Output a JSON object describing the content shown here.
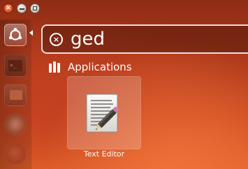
{
  "window_controls": {
    "close_glyph": "×",
    "minimize_icon": "minimize-icon",
    "maximize_icon": "maximize-icon"
  },
  "launcher": {
    "items": [
      {
        "name": "dash-home",
        "icon": "ubuntu-logo-icon",
        "active": true
      },
      {
        "name": "terminal",
        "icon": "terminal-icon",
        "glyph": ">_"
      },
      {
        "name": "files",
        "icon": "files-icon"
      },
      {
        "name": "browser",
        "icon": "chromium-icon"
      },
      {
        "name": "firefox",
        "icon": "firefox-icon"
      }
    ]
  },
  "search": {
    "value": "ged",
    "clear_glyph": "×"
  },
  "category": {
    "label": "Applications",
    "icon": "applications-icon"
  },
  "results": [
    {
      "label": "Text Editor",
      "icon": "text-editor-icon",
      "highlighted": true
    }
  ],
  "colors": {
    "accent": "#e4521d",
    "background_top": "#8e2c14",
    "background_bottom": "#e2622b",
    "text": "#ffffff"
  }
}
